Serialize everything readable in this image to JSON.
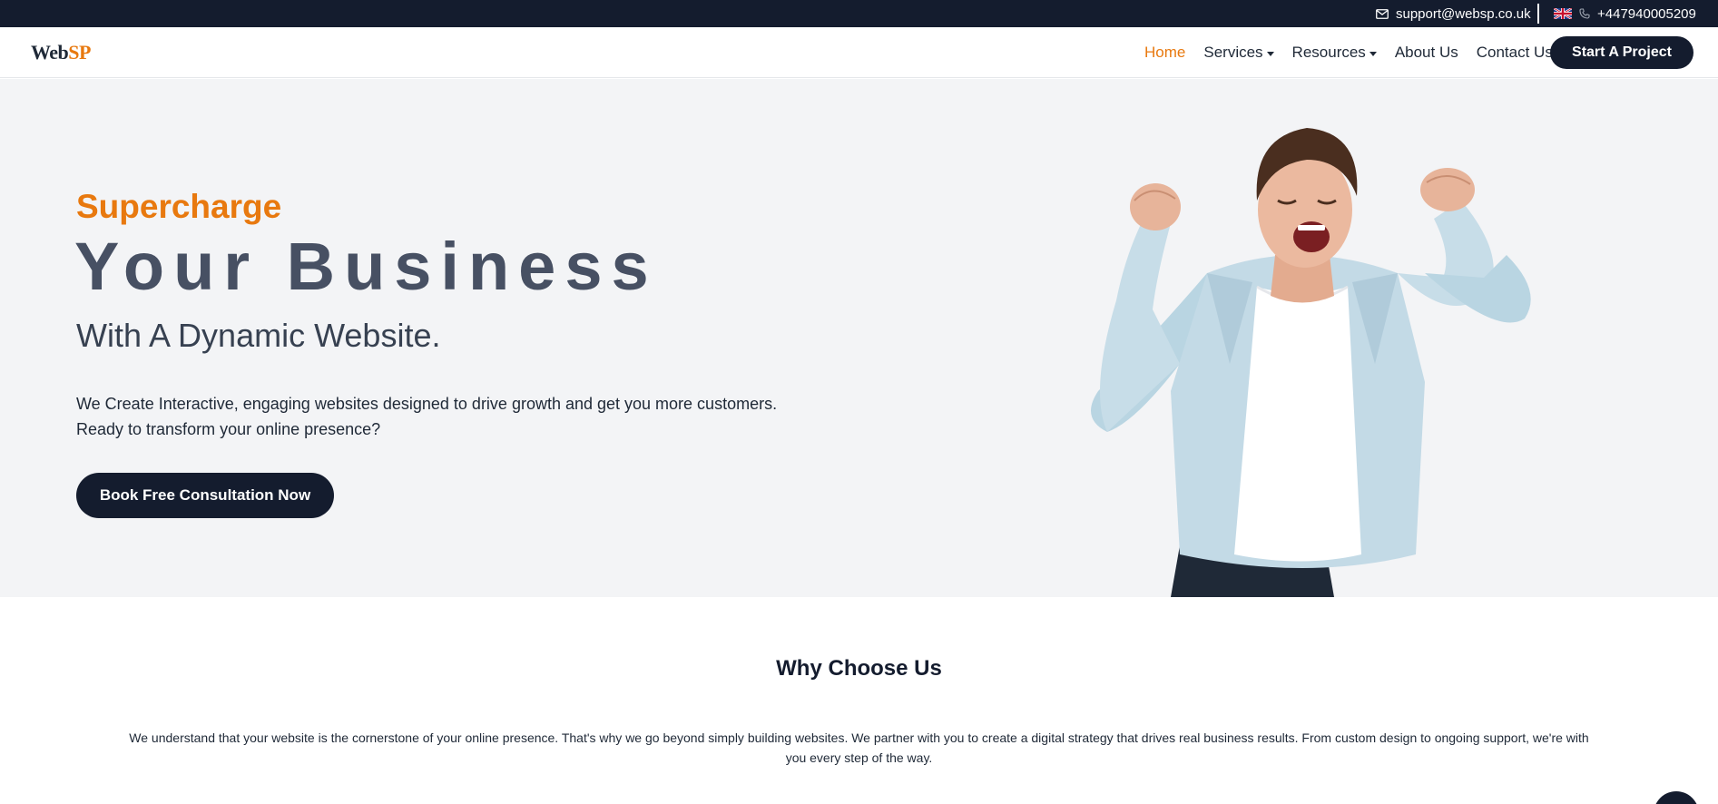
{
  "topbar": {
    "email": "support@websp.co.uk",
    "phone": "+447940005209",
    "flag_icon": "uk-flag-icon"
  },
  "brand": {
    "logo_part1": "Web",
    "logo_part2": "SP",
    "accent_color": "#e8790f",
    "dark_color": "#141c2e"
  },
  "nav": {
    "items": [
      {
        "label": "Home",
        "active": true
      },
      {
        "label": "Services",
        "dropdown": true
      },
      {
        "label": "Resources",
        "dropdown": true
      },
      {
        "label": "About Us"
      },
      {
        "label": "Contact Us"
      }
    ],
    "cta_label": "Start A Project"
  },
  "hero": {
    "kicker": "Supercharge",
    "headline": "Your Business",
    "subhead": "With A Dynamic Website.",
    "description_line1": "We Create Interactive, engaging websites designed to drive growth and get you more customers.",
    "description_line2": "Ready to transform your online presence?",
    "cta_label": "Book Free Consultation Now"
  },
  "why": {
    "title": "Why Choose Us",
    "text": "We understand that your website is the cornerstone of your online presence. That's why we go beyond simply building websites. We partner with you to create a digital strategy that drives real business results. From custom design to ongoing support, we're with you every step of the way."
  }
}
